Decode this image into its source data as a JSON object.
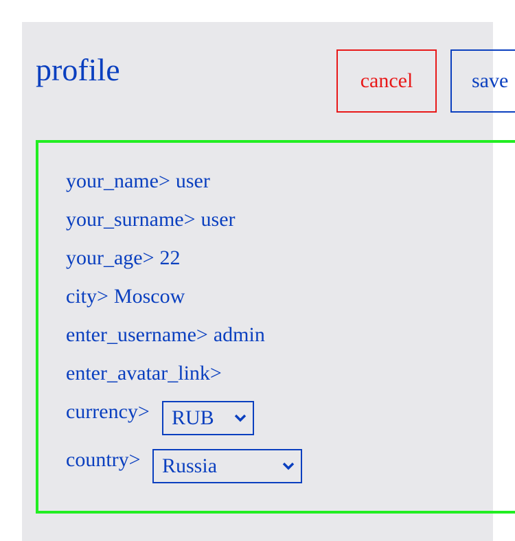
{
  "header": {
    "title": "profile",
    "cancel_label": "cancel",
    "save_label": "save"
  },
  "fields": [
    {
      "label": "your_name>",
      "value": "user"
    },
    {
      "label": "your_surname>",
      "value": "user"
    },
    {
      "label": "your_age>",
      "value": "22"
    },
    {
      "label": "city>",
      "value": "Moscow"
    },
    {
      "label": "enter_username>",
      "value": "admin"
    },
    {
      "label": "enter_avatar_link>",
      "value": ""
    }
  ],
  "currency": {
    "label": "currency>",
    "selected": "RUB"
  },
  "country": {
    "label": "country>",
    "selected": "Russia"
  },
  "icons": {
    "dropdown": "chevron-down-icon"
  },
  "colors": {
    "text": "#0a3fbf",
    "cancel": "#e81818",
    "form_border": "#22ee22",
    "panel": "#e8e8eb"
  }
}
